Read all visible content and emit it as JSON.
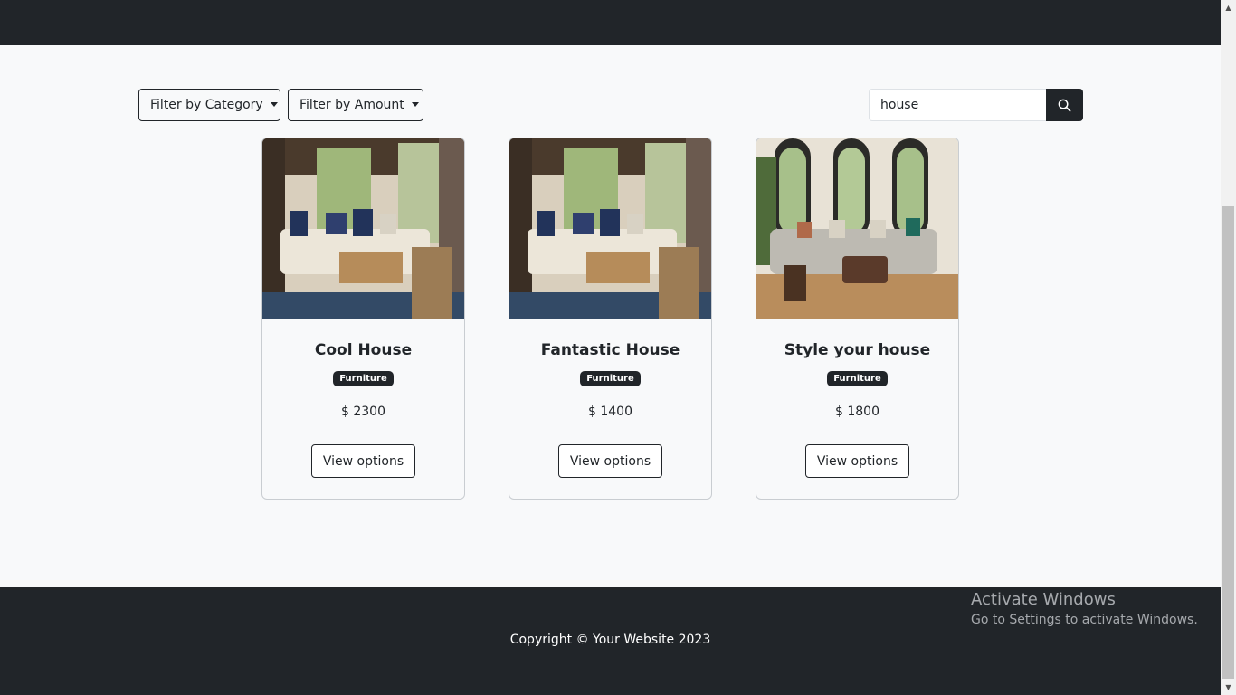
{
  "filters": {
    "category_label": "Filter by Category",
    "amount_label": "Filter by Amount"
  },
  "search": {
    "value": "house"
  },
  "products": [
    {
      "title": "Cool House",
      "badge": "Furniture",
      "price": "$ 2300",
      "button": "View options"
    },
    {
      "title": "Fantastic House",
      "badge": "Furniture",
      "price": "$ 1400",
      "button": "View options"
    },
    {
      "title": "Style your house",
      "badge": "Furniture",
      "price": "$ 1800",
      "button": "View options"
    }
  ],
  "footer": {
    "copyright": "Copyright © Your Website 2023"
  },
  "watermark": {
    "title": "Activate Windows",
    "subtitle": "Go to Settings to activate Windows."
  },
  "colors": {
    "dark": "#212529",
    "light": "#f8f9fa"
  }
}
